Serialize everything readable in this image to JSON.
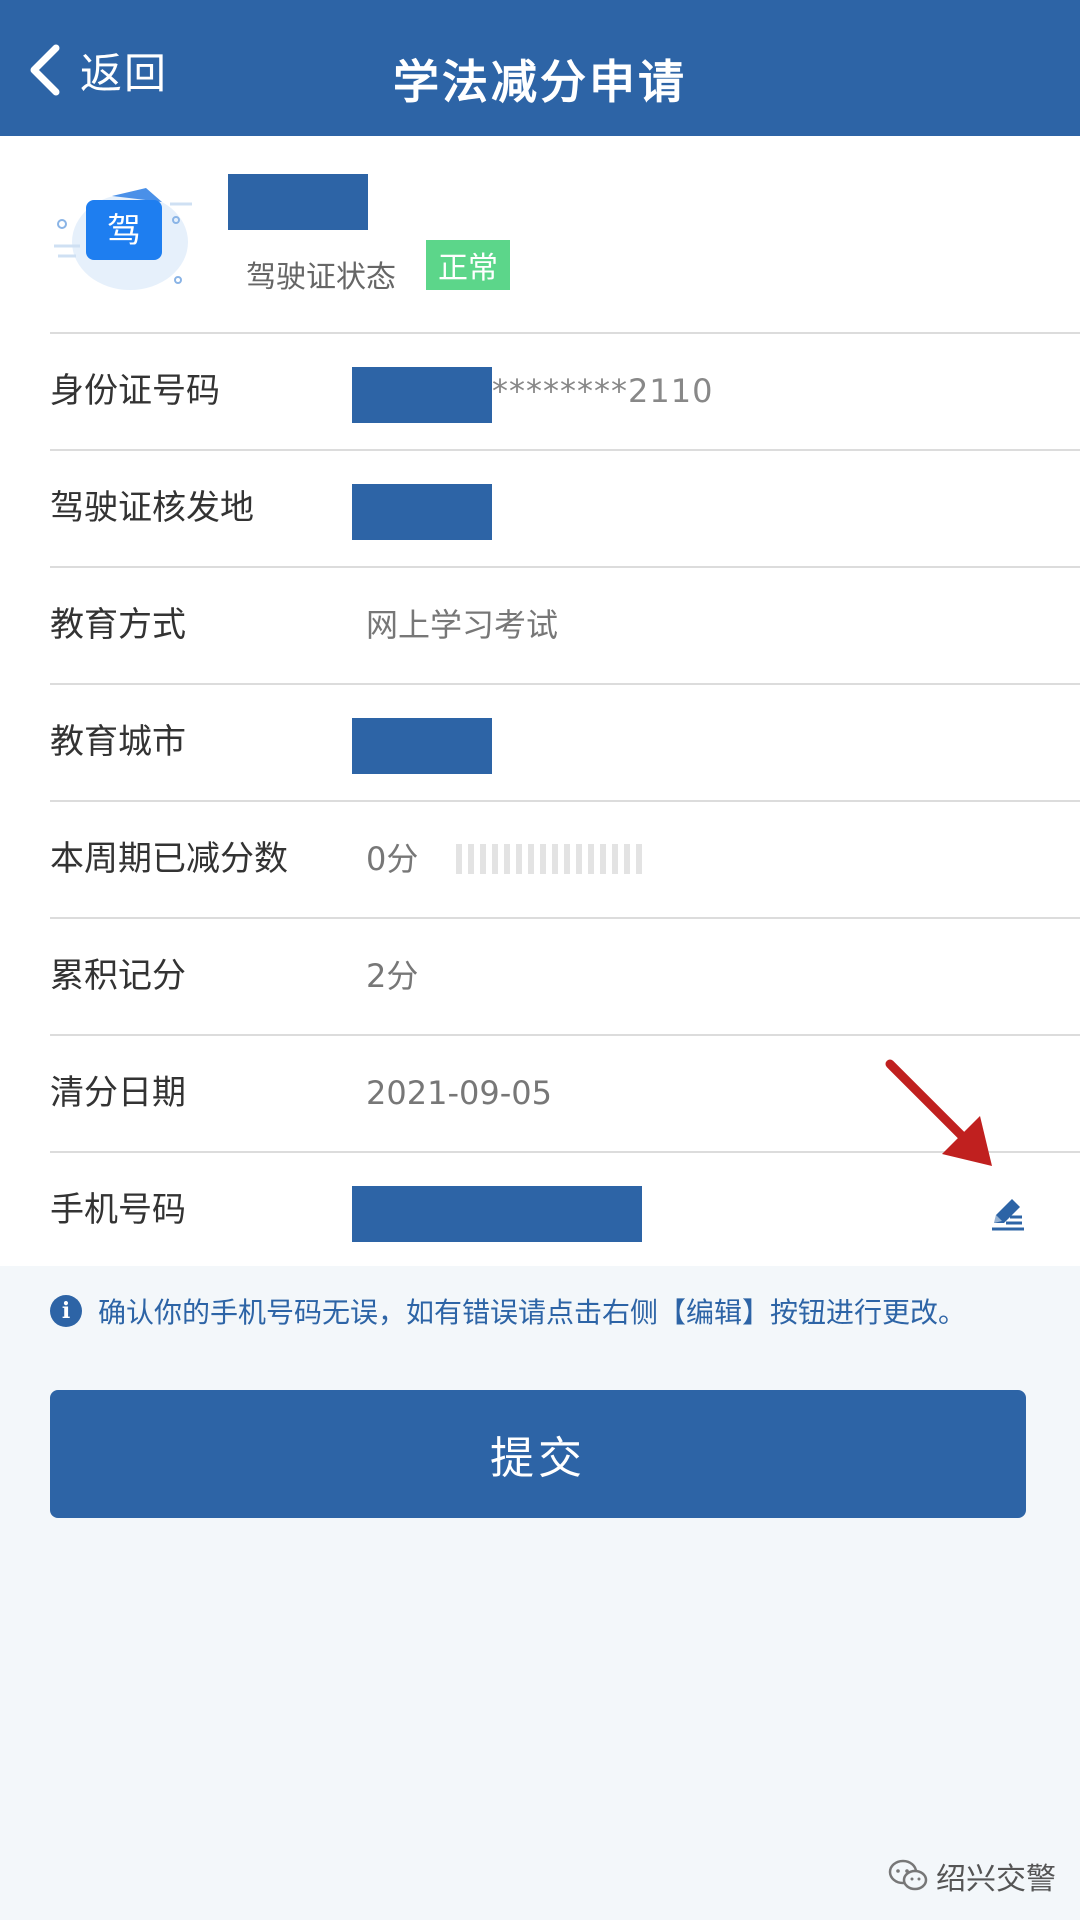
{
  "header": {
    "back_label": "返回",
    "title": "学法减分申请"
  },
  "profile": {
    "icon_char": "驾",
    "status_label": "驾驶证状态",
    "status_value": "正常"
  },
  "rows": {
    "id_number": {
      "label": "身份证号码",
      "value_masked": "********2110"
    },
    "issue_place": {
      "label": "驾驶证核发地"
    },
    "education_method": {
      "label": "教育方式",
      "value": "网上学习考试"
    },
    "education_city": {
      "label": "教育城市"
    },
    "deducted_this_cycle": {
      "label": "本周期已减分数",
      "value": "0分"
    },
    "accumulated_points": {
      "label": "累积记分",
      "value": "2分"
    },
    "clear_date": {
      "label": "清分日期",
      "value": "2021-09-05"
    },
    "phone": {
      "label": "手机号码"
    }
  },
  "notice": {
    "icon": "i",
    "text": "确认你的手机号码无误，如有错误请点击右侧【编辑】按钮进行更改。"
  },
  "submit_label": "提交",
  "watermark": "绍兴交警",
  "colors": {
    "primary": "#2d64a6",
    "status_green": "#5cd68a",
    "annotation_red": "#c0201f"
  },
  "icons": {
    "back": "chevron-left-icon",
    "license": "driving-license-icon",
    "edit": "edit-pen-icon",
    "info": "info-icon",
    "annotation": "red-arrow-icon",
    "watermark": "wechat-icon"
  }
}
